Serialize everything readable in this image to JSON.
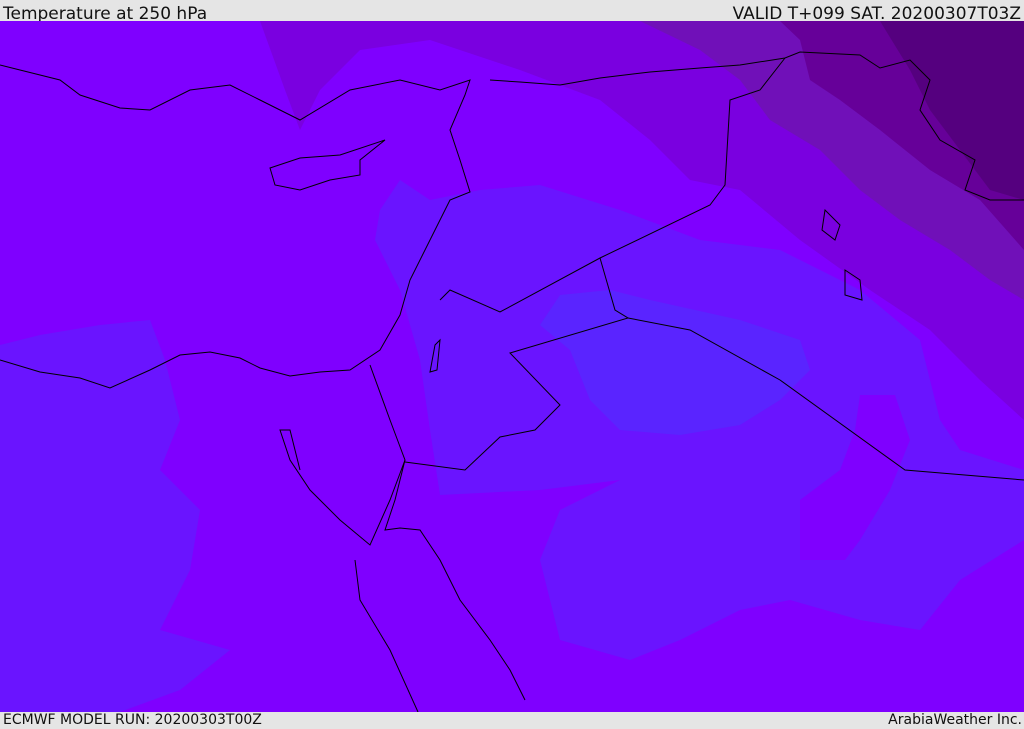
{
  "header": {
    "title": "Temperature at 250 hPa",
    "valid": "VALID T+099 SAT. 20200307T03Z"
  },
  "footer": {
    "model_run": "ECMWF MODEL RUN: 20200303T00Z",
    "credit": "ArabiaWeather Inc."
  },
  "colors": {
    "base": "#7f00ff",
    "cooler": "#6a14ff",
    "coolest": "#5a24ff",
    "warm1": "#7a00e0",
    "warm2": "#7010b8",
    "warm3": "#660099",
    "warm4": "#55007f"
  }
}
